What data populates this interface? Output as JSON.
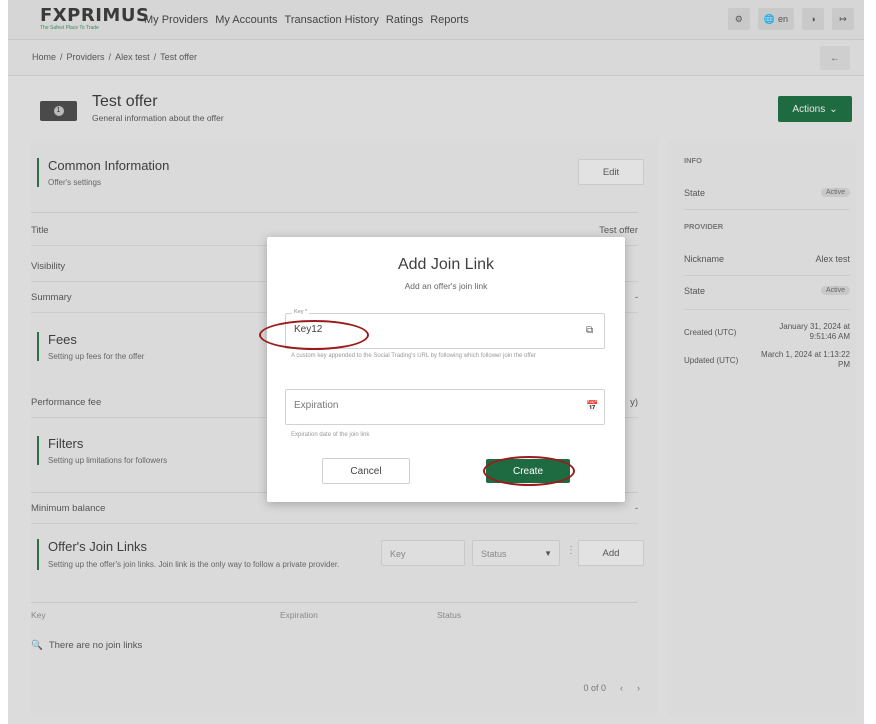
{
  "brand": {
    "name": "FXPRIMUS",
    "tagline": "The Safest Place To Trade"
  },
  "nav": {
    "links": [
      "My Providers",
      "My Accounts",
      "Transaction History",
      "Ratings",
      "Reports"
    ],
    "lang_label": "en"
  },
  "breadcrumb": [
    "Home",
    "/",
    "Providers",
    "/",
    "Alex test",
    "/",
    "Test offer"
  ],
  "page": {
    "title": "Test offer",
    "subtitle": "General information about the offer",
    "actions_label": "Actions",
    "icon_digit": "1"
  },
  "common": {
    "title": "Common Information",
    "subtitle": "Offer's settings",
    "edit_label": "Edit",
    "rows": [
      {
        "label": "Title",
        "value": "Test offer"
      },
      {
        "label": "Visibility",
        "value": ""
      },
      {
        "label": "Summary",
        "value": "-"
      }
    ]
  },
  "fees": {
    "title": "Fees",
    "subtitle": "Setting up fees for the offer",
    "perf_label": "Performance fee",
    "perf_value": "y)"
  },
  "filters": {
    "title": "Filters",
    "subtitle": "Setting up limitations for followers",
    "min_balance_label": "Minimum balance",
    "min_balance_value": "-"
  },
  "join_links": {
    "title": "Offer's Join Links",
    "subtitle": "Setting up the offer's join links. Join link is the only way to follow a private provider.",
    "key_placeholder": "Key",
    "status_placeholder": "Status",
    "add_label": "Add",
    "columns": [
      "Key",
      "Expiration",
      "Status"
    ],
    "empty_text": "There are no join links",
    "pager_text": "0 of 0"
  },
  "info_panel": {
    "info_caption": "INFO",
    "state_label": "State",
    "state_value": "Active",
    "provider_caption": "PROVIDER",
    "nickname_label": "Nickname",
    "nickname_value": "Alex test",
    "provider_state_label": "State",
    "provider_state_value": "Active",
    "created_label": "Created (UTC)",
    "created_value": "January 31, 2024 at 9:51:46 AM",
    "updated_label": "Updated (UTC)",
    "updated_value": "March 1, 2024 at 1:13:22 PM"
  },
  "modal": {
    "title": "Add Join Link",
    "subtitle": "Add an offer's join link",
    "key_label": "Key *",
    "key_value": "Key12",
    "key_hint": "A custom key appended to the Social Trading's URL by following which follower join the offer",
    "expiration_placeholder": "Expiration",
    "expiration_hint": "Expiration date of the join link",
    "cancel_label": "Cancel",
    "create_label": "Create"
  },
  "colors": {
    "accent": "#1e6b42",
    "highlight_ring": "#9b1b1b"
  }
}
